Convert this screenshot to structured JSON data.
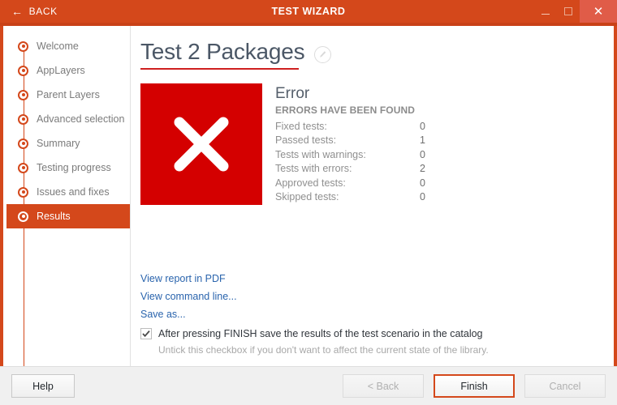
{
  "titlebar": {
    "back_label": "BACK",
    "back_icon": "arrow-left-icon",
    "app_title": "TEST WIZARD",
    "minimize_icon": "minimize-icon",
    "maximize_icon": "maximize-icon",
    "close_icon": "close-icon",
    "close_glyph": "✕",
    "back_glyph": "←",
    "accent_color": "#d4481b",
    "close_button_color": "#e05c48"
  },
  "sidebar": {
    "items": [
      {
        "label": "Welcome",
        "active": false
      },
      {
        "label": "AppLayers",
        "active": false
      },
      {
        "label": "Parent Layers",
        "active": false
      },
      {
        "label": "Advanced selection",
        "active": false
      },
      {
        "label": "Summary",
        "active": false
      },
      {
        "label": "Testing progress",
        "active": false
      },
      {
        "label": "Issues and fixes",
        "active": false
      },
      {
        "label": "Results",
        "active": true
      }
    ]
  },
  "content": {
    "page_title": "Test 2 Packages",
    "edit_icon": "pencil-edit-icon",
    "status": {
      "icon": "error-cross-icon",
      "icon_color": "#d40000",
      "heading": "Error",
      "subheading": "ERRORS HAVE BEEN FOUND",
      "rows": [
        {
          "label": "Fixed tests:",
          "value": "0"
        },
        {
          "label": "Passed tests:",
          "value": "1"
        },
        {
          "label": "Tests with warnings:",
          "value": "0"
        },
        {
          "label": "Tests with errors:",
          "value": "2"
        },
        {
          "label": "Approved tests:",
          "value": "0"
        },
        {
          "label": "Skipped tests:",
          "value": "0"
        }
      ]
    },
    "links": [
      "View report in PDF",
      "View command line...",
      "Save as..."
    ],
    "checkbox": {
      "checked": true,
      "label": "After pressing FINISH save the results of the test scenario in the catalog",
      "hint": "Untick this checkbox if you don't want to affect the current state of the library."
    }
  },
  "footer": {
    "help_label": "Help",
    "back_label": "< Back",
    "finish_label": "Finish",
    "cancel_label": "Cancel"
  }
}
